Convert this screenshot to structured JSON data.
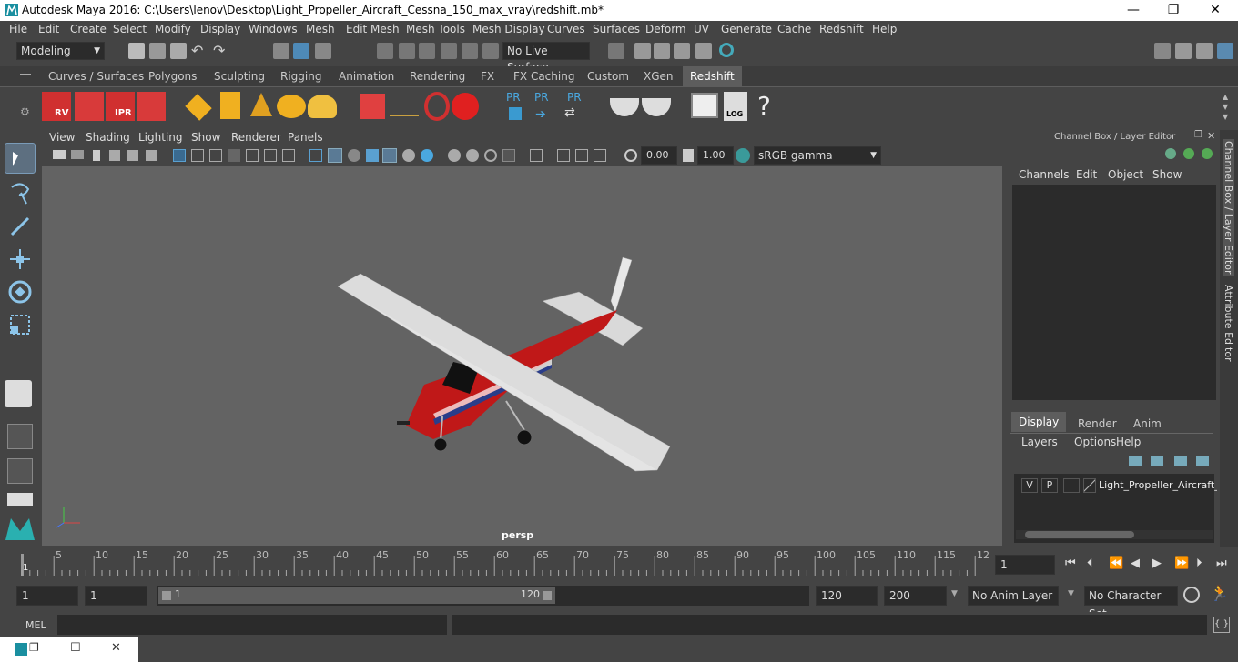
{
  "window": {
    "title": "Autodesk Maya 2016: C:\\Users\\lenov\\Desktop\\Light_Propeller_Aircraft_Cessna_150_max_vray\\redshift.mb*",
    "minimize_glyph": "—",
    "maximize_glyph": "❐",
    "close_glyph": "✕"
  },
  "menubar": [
    "File",
    "Edit",
    "Create",
    "Select",
    "Modify",
    "Display",
    "Windows",
    "Mesh",
    "Edit Mesh",
    "Mesh Tools",
    "Mesh Display",
    "Curves",
    "Surfaces",
    "Deform",
    "UV",
    "Generate",
    "Cache",
    "Redshift",
    "Help"
  ],
  "statusline": {
    "mode": "Modeling",
    "live_surface": "No Live Surface"
  },
  "shelf": {
    "tabs": [
      "Curves / Surfaces",
      "Polygons",
      "Sculpting",
      "Rigging",
      "Animation",
      "Rendering",
      "FX",
      "FX Caching",
      "Custom",
      "XGen",
      "Redshift"
    ],
    "active_tab": "Redshift",
    "icons": [
      "RV",
      "IPR",
      "PR",
      "PR",
      "PR",
      "LOG",
      "?"
    ]
  },
  "viewport": {
    "menus": [
      "View",
      "Shading",
      "Lighting",
      "Show",
      "Renderer",
      "Panels"
    ],
    "exposure": "0.00",
    "gamma": "1.00",
    "color_space": "sRGB gamma",
    "camera_label": "persp"
  },
  "channel_box": {
    "title": "Channel Box / Layer Editor",
    "menus": [
      "Channels",
      "Edit",
      "Object",
      "Show"
    ],
    "layer_tabs": [
      "Display",
      "Render",
      "Anim"
    ],
    "layer_menus": [
      "Layers",
      "Options",
      "Help"
    ],
    "layer": {
      "v": "V",
      "p": "P",
      "name": "Light_Propeller_Aircraft_"
    }
  },
  "side_tabs": [
    "Channel Box / Layer Editor",
    "Attribute Editor"
  ],
  "timeline": {
    "ticks": [
      "5",
      "10",
      "15",
      "20",
      "25",
      "30",
      "35",
      "40",
      "45",
      "50",
      "55",
      "60",
      "65",
      "70",
      "75",
      "80",
      "85",
      "90",
      "95",
      "100",
      "105",
      "110",
      "115",
      "12"
    ],
    "start_marker": "1",
    "current_frame": "1"
  },
  "range": {
    "start": "1",
    "playback_start": "1",
    "slider_start": "1",
    "slider_end": "120",
    "playback_end": "120",
    "end": "200",
    "anim_layer": "No Anim Layer",
    "character_set": "No Character Set"
  },
  "cmdline": {
    "label": "MEL"
  },
  "colors": {
    "accent": "#5d5d5d",
    "panel": "#444444",
    "viewport": "#636363",
    "highlight": "#4e8ab8"
  }
}
